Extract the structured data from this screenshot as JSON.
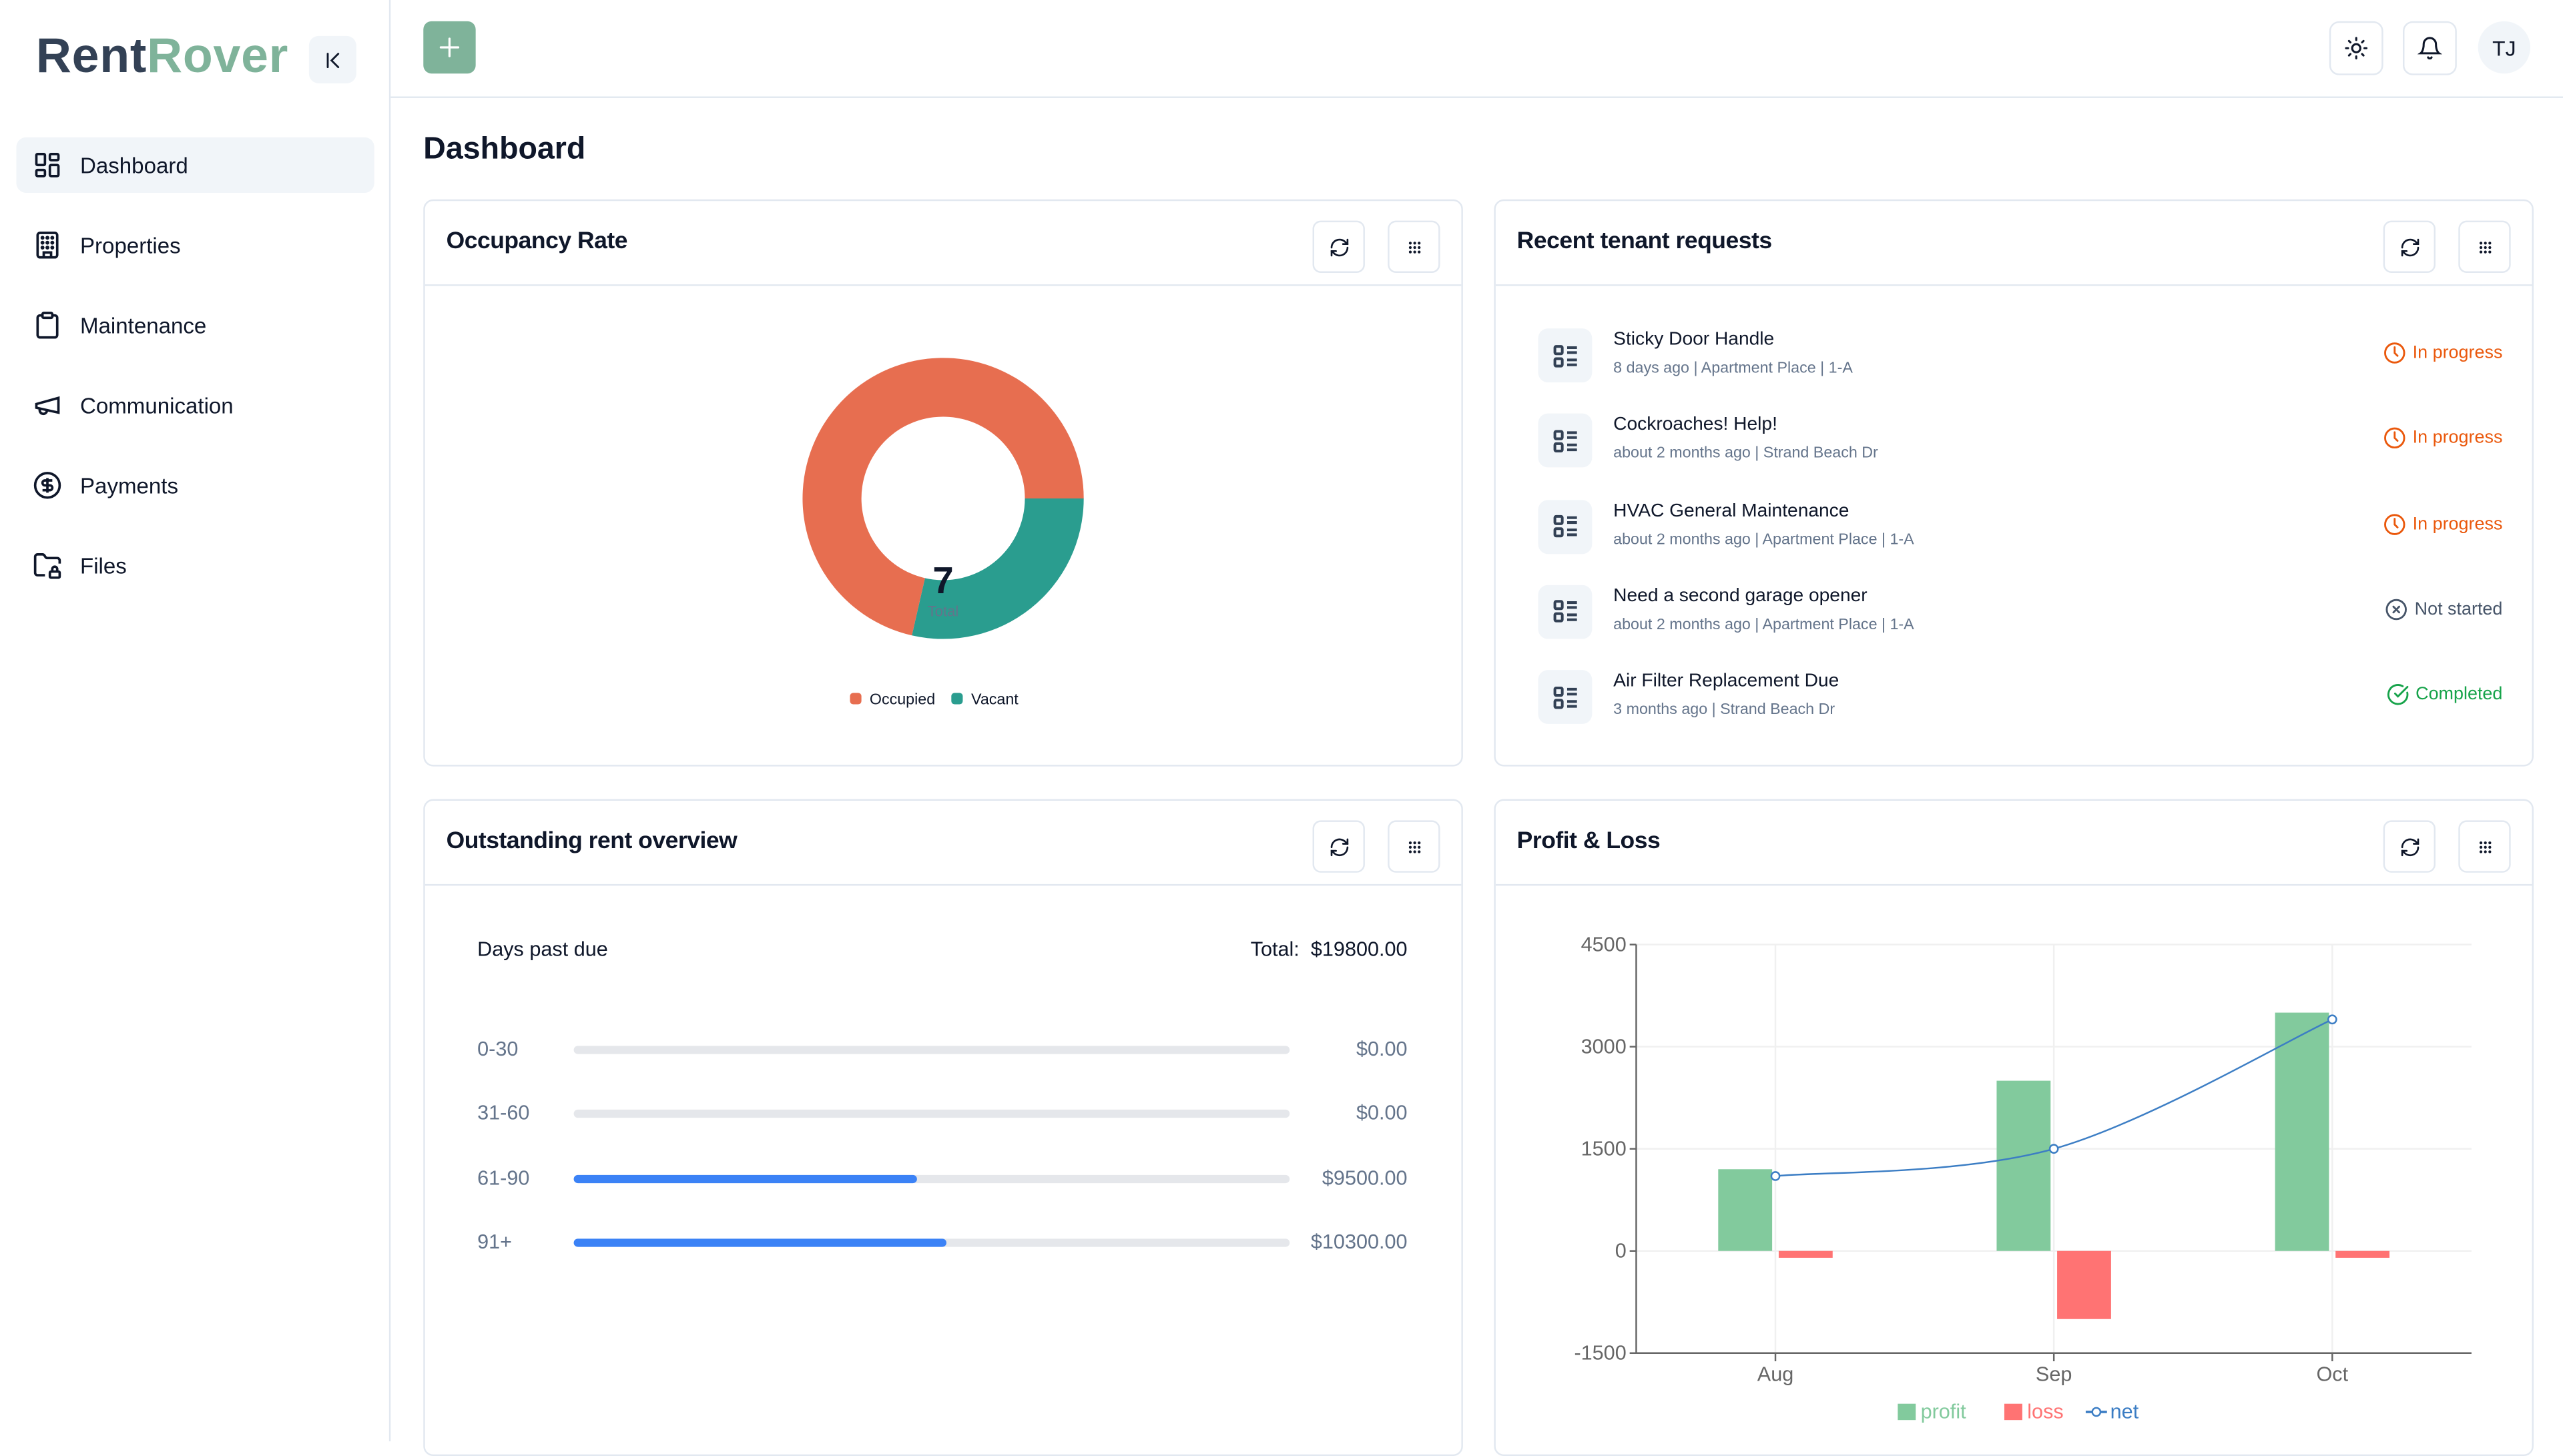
{
  "app": {
    "logo_part1": "Rent",
    "logo_part2": "Rover",
    "brand_color": "#7fb39a"
  },
  "sidebar": {
    "items": [
      {
        "label": "Dashboard",
        "icon": "dashboard-icon",
        "active": true
      },
      {
        "label": "Properties",
        "icon": "building-icon"
      },
      {
        "label": "Maintenance",
        "icon": "clipboard-icon"
      },
      {
        "label": "Communication",
        "icon": "megaphone-icon"
      },
      {
        "label": "Payments",
        "icon": "dollar-circle-icon"
      },
      {
        "label": "Files",
        "icon": "folder-lock-icon"
      }
    ]
  },
  "topbar": {
    "avatar_initials": "TJ"
  },
  "page": {
    "title": "Dashboard"
  },
  "occupancy": {
    "title": "Occupancy Rate",
    "total": "7",
    "total_label": "Total"
  },
  "requests": {
    "title": "Recent tenant requests",
    "items": [
      {
        "title": "Sticky Door Handle",
        "sub": "8 days ago | Apartment Place | 1-A",
        "status": "In progress",
        "status_type": "progress"
      },
      {
        "title": "Cockroaches! Help!",
        "sub": "about 2 months ago | Strand Beach Dr",
        "status": "In progress",
        "status_type": "progress"
      },
      {
        "title": "HVAC General Maintenance",
        "sub": "about 2 months ago | Apartment Place | 1-A",
        "status": "In progress",
        "status_type": "progress"
      },
      {
        "title": "Need a second garage opener",
        "sub": "about 2 months ago | Apartment Place | 1-A",
        "status": "Not started",
        "status_type": "notstarted"
      },
      {
        "title": "Air Filter Replacement Due",
        "sub": "3 months ago | Strand Beach Dr",
        "status": "Completed",
        "status_type": "completed"
      }
    ],
    "status_colors": {
      "progress": "#ea580c",
      "notstarted": "#475569",
      "completed": "#16a34a"
    }
  },
  "rent": {
    "title": "Outstanding rent overview",
    "heading": "Days past due",
    "total_label": "Total:",
    "total_value": "$19800.00",
    "rows": [
      {
        "label": "0-30",
        "amount": "$0.00",
        "fraction": 0
      },
      {
        "label": "31-60",
        "amount": "$0.00",
        "fraction": 0
      },
      {
        "label": "61-90",
        "amount": "$9500.00",
        "fraction": 0.48
      },
      {
        "label": "91+",
        "amount": "$10300.00",
        "fraction": 0.52
      }
    ]
  },
  "pnl": {
    "title": "Profit & Loss"
  },
  "chart_data": [
    {
      "type": "pie",
      "title": "Occupancy Rate",
      "donut": true,
      "center_value": "7",
      "center_label": "Total",
      "categories": [
        "Occupied",
        "Vacant"
      ],
      "values": [
        5,
        2
      ],
      "colors": [
        "#e76e50",
        "#2a9d8f"
      ],
      "legend": "bottom"
    },
    {
      "type": "bar",
      "title": "Profit & Loss",
      "categories": [
        "Aug",
        "Sep",
        "Oct"
      ],
      "series": [
        {
          "name": "profit",
          "type": "bar",
          "values": [
            1200,
            2500,
            3500
          ],
          "color": "#82ca9d"
        },
        {
          "name": "loss",
          "type": "bar",
          "values": [
            -100,
            -1000,
            -100
          ],
          "color": "#ff7373"
        },
        {
          "name": "net",
          "type": "line",
          "values": [
            1100,
            1500,
            3400
          ],
          "color": "#3b7dc4"
        }
      ],
      "yticks": [
        -1500,
        0,
        1500,
        3000,
        4500
      ],
      "ylim": [
        -1500,
        4500
      ],
      "grid": true,
      "legend": "bottom"
    }
  ]
}
